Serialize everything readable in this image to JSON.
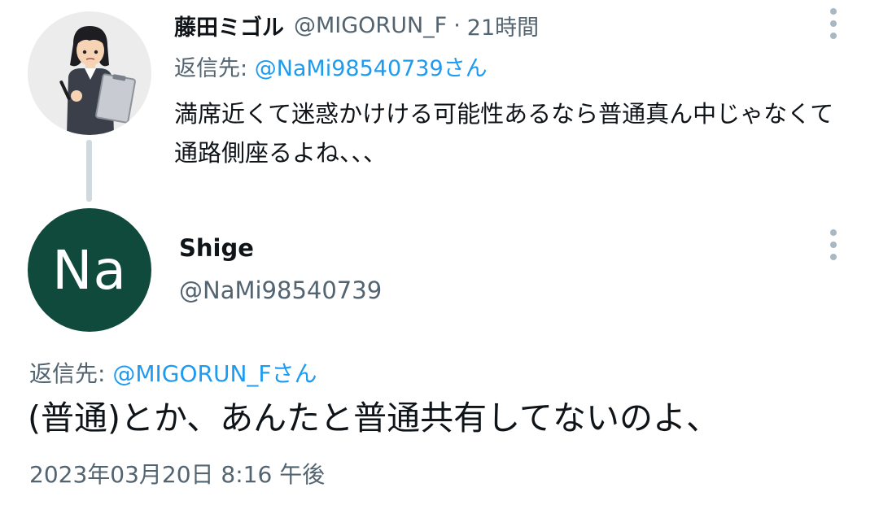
{
  "parent_tweet": {
    "display_name": "藤田ミゴル",
    "handle": "@MIGORUN_F",
    "separator": "·",
    "time_ago": "21時間",
    "reply_prefix": "返信先: ",
    "reply_mention": "@NaMi98540739さん",
    "body": "満席近くて迷惑かけける可能性あるなら普通真ん中じゃなくて通路側座るよね、、、"
  },
  "main_tweet": {
    "avatar_initials": "Na",
    "avatar_color": "#0f4a3c",
    "display_name": "Shige",
    "handle": "@NaMi98540739",
    "reply_prefix": "返信先: ",
    "reply_mention": "@MIGORUN_Fさん",
    "body": "(普通)とか、あんたと普通共有してないのよ、",
    "timestamp": "2023年03月20日 8:16 午後"
  },
  "colors": {
    "link": "#1d9bf0",
    "muted_text": "#536471",
    "thread_line": "#cfd9de"
  },
  "icons": [
    "more-vertical-icon",
    "profile-illustration-avatar"
  ]
}
